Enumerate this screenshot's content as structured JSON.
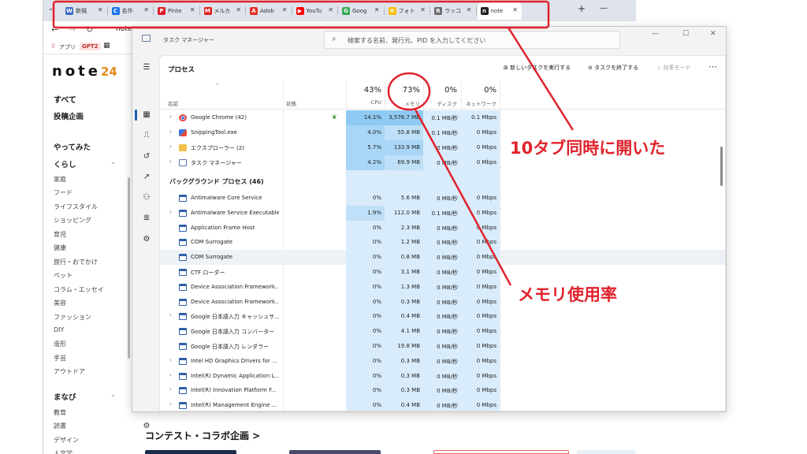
{
  "browser": {
    "tabs": [
      {
        "label": "新規",
        "fav_color": "#3a6fc4",
        "fav_char": "W"
      },
      {
        "label": "名作",
        "fav_color": "#1a73e8",
        "fav_char": "C"
      },
      {
        "label": "Pinte",
        "fav_color": "#e0192b",
        "fav_char": "P"
      },
      {
        "label": "メルカ",
        "fav_color": "#e02020",
        "fav_char": "M"
      },
      {
        "label": "Adob",
        "fav_color": "#e8302a",
        "fav_char": "A"
      },
      {
        "label": "YouTu",
        "fav_color": "#ff0000",
        "fav_char": "▶"
      },
      {
        "label": "Goog",
        "fav_color": "#34a853",
        "fav_char": "G"
      },
      {
        "label": "フォト",
        "fav_color": "#fbbc04",
        "fav_char": "✿"
      },
      {
        "label": "ラッコ",
        "fav_color": "#6b6b6b",
        "fav_char": "R"
      },
      {
        "label": "note",
        "fav_color": "#222222",
        "fav_char": "n"
      }
    ],
    "url": "note.",
    "bookmarks": {
      "apps": "アプリ",
      "gpt": "GPT2"
    },
    "colors": {
      "tabstrip": "#dfe3eb"
    }
  },
  "note": {
    "logo": "note",
    "logo_num": "24",
    "sidebar": [
      {
        "label": "すべて",
        "style": "bold"
      },
      {
        "label": "投稿企画",
        "style": "head"
      },
      {
        "label": "やってみた",
        "style": "head"
      },
      {
        "label": "くらし",
        "style": "head"
      },
      {
        "label": "家庭",
        "style": "small"
      },
      {
        "label": "フード",
        "style": "small"
      },
      {
        "label": "ライフスタイル",
        "style": "small"
      },
      {
        "label": "ショッピング",
        "style": "small"
      },
      {
        "label": "育児",
        "style": "small"
      },
      {
        "label": "健康",
        "style": "small"
      },
      {
        "label": "旅行・おでかけ",
        "style": "small"
      },
      {
        "label": "ペット",
        "style": "small"
      },
      {
        "label": "コラム・エッセイ",
        "style": "small"
      },
      {
        "label": "美容",
        "style": "small"
      },
      {
        "label": "ファッション",
        "style": "small"
      },
      {
        "label": "DIY",
        "style": "small"
      },
      {
        "label": "造形",
        "style": "small"
      },
      {
        "label": "手芸",
        "style": "small"
      },
      {
        "label": "アウトドア",
        "style": "small"
      },
      {
        "label": "まなび",
        "style": "head"
      },
      {
        "label": "教育",
        "style": "small"
      },
      {
        "label": "読書",
        "style": "small"
      },
      {
        "label": "デザイン",
        "style": "small"
      },
      {
        "label": "人文学",
        "style": "small"
      }
    ],
    "contest_heading": "コンテスト・コラボ企画 >"
  },
  "taskmanager": {
    "title": "タスク マネージャー",
    "search_placeholder": "検索する名前、発行元、PID を入力してください",
    "page_title": "プロセス",
    "toolbar": {
      "run_task": "新しいタスクを実行する",
      "end_task": "タスクを終了する",
      "efficiency": "効率モード"
    },
    "columns": {
      "name": "名前",
      "status": "状態",
      "cpu_pct": "43%",
      "cpu": "CPU",
      "mem_pct": "73%",
      "mem": "メモリ",
      "disk_pct": "0%",
      "disk": "ディスク",
      "net_pct": "0%",
      "net": "ネットワーク"
    },
    "apps": [
      {
        "name": "Google Chrome (42)",
        "cpu": "14.1%",
        "mem": "3,576.7 MB",
        "disk": "0.1 MB/秒",
        "net": "0.1 Mbps",
        "icon": "chrome",
        "exp": true,
        "leaf": true,
        "cpu_level": 3,
        "mem_level": 3
      },
      {
        "name": "SnippingTool.exe",
        "cpu": "4.0%",
        "mem": "55.8 MB",
        "disk": "0.1 MB/秒",
        "net": "0 Mbps",
        "icon": "snip",
        "exp": true,
        "leaf": false,
        "cpu_level": 2,
        "mem_level": 1
      },
      {
        "name": "エクスプローラー (2)",
        "cpu": "5.7%",
        "mem": "133.9 MB",
        "disk": "0 MB/秒",
        "net": "0 Mbps",
        "icon": "folder",
        "exp": true,
        "leaf": false,
        "cpu_level": 2,
        "mem_level": 2
      },
      {
        "name": "タスク マネージャー",
        "cpu": "4.2%",
        "mem": "69.9 MB",
        "disk": "0 MB/秒",
        "net": "0 Mbps",
        "icon": "tm",
        "exp": true,
        "leaf": false,
        "cpu_level": 2,
        "mem_level": 1
      }
    ],
    "bg_heading": "バックグラウンド プロセス (46)",
    "background": [
      {
        "name": "Antimalware Core Service",
        "cpu": "0%",
        "mem": "5.6 MB",
        "disk": "0 MB/秒",
        "net": "0 Mbps",
        "exp": false,
        "cpu_level": 0
      },
      {
        "name": "Antimalware Service Executable",
        "cpu": "1.9%",
        "mem": "112.0 MB",
        "disk": "0.1 MB/秒",
        "net": "0 Mbps",
        "exp": true,
        "cpu_level": 1
      },
      {
        "name": "Application Frame Host",
        "cpu": "0%",
        "mem": "2.3 MB",
        "disk": "0 MB/秒",
        "net": "0 Mbps",
        "exp": false,
        "cpu_level": 0
      },
      {
        "name": "COM Surrogate",
        "cpu": "0%",
        "mem": "1.2 MB",
        "disk": "0 MB/秒",
        "net": "0 Mbps",
        "exp": false,
        "cpu_level": 0
      },
      {
        "name": "COM Surrogate",
        "cpu": "0%",
        "mem": "0.8 MB",
        "disk": "0 MB/秒",
        "net": "0 Mbps",
        "exp": false,
        "cpu_level": 0,
        "hl": true
      },
      {
        "name": "CTF ローダー",
        "cpu": "0%",
        "mem": "3.1 MB",
        "disk": "0 MB/秒",
        "net": "0 Mbps",
        "exp": false,
        "cpu_level": 0
      },
      {
        "name": "Device Association Framework...",
        "cpu": "0%",
        "mem": "1.3 MB",
        "disk": "0 MB/秒",
        "net": "0 Mbps",
        "exp": false,
        "cpu_level": 0
      },
      {
        "name": "Device Association Framework...",
        "cpu": "0%",
        "mem": "0.3 MB",
        "disk": "0 MB/秒",
        "net": "0 Mbps",
        "exp": false,
        "cpu_level": 0
      },
      {
        "name": "Google 日本語入力 キャッシュサ...",
        "cpu": "0%",
        "mem": "0.4 MB",
        "disk": "0 MB/秒",
        "net": "0 Mbps",
        "exp": true,
        "cpu_level": 0
      },
      {
        "name": "Google 日本語入力 コンバーター",
        "cpu": "0%",
        "mem": "4.1 MB",
        "disk": "0 MB/秒",
        "net": "0 Mbps",
        "exp": false,
        "cpu_level": 0
      },
      {
        "name": "Google 日本語入力 レンダラー",
        "cpu": "0%",
        "mem": "19.8 MB",
        "disk": "0 MB/秒",
        "net": "0 Mbps",
        "exp": false,
        "cpu_level": 0
      },
      {
        "name": "Intel HD Graphics Drivers for ...",
        "cpu": "0%",
        "mem": "0.3 MB",
        "disk": "0 MB/秒",
        "net": "0 Mbps",
        "exp": true,
        "cpu_level": 0
      },
      {
        "name": "Intel(R) Dynamic Application L...",
        "cpu": "0%",
        "mem": "0.3 MB",
        "disk": "0 MB/秒",
        "net": "0 Mbps",
        "exp": true,
        "cpu_level": 0
      },
      {
        "name": "Intel(R) Innovation Platform F...",
        "cpu": "0%",
        "mem": "0.3 MB",
        "disk": "0 MB/秒",
        "net": "0 Mbps",
        "exp": true,
        "cpu_level": 0
      },
      {
        "name": "Intel(R) Management Engine ...",
        "cpu": "0%",
        "mem": "0.4 MB",
        "disk": "0 MB/秒",
        "net": "0 Mbps",
        "exp": true,
        "cpu_level": 0
      }
    ],
    "colors": {
      "heat0": "#d9ecfb",
      "heat1": "#bfe0f8",
      "heat2": "#a9d6f6",
      "heat3": "#8fcaf3"
    }
  },
  "annotations": {
    "tabs_note": "10タブ同時に開いた",
    "memory_note": "メモリ使用率",
    "color": "#e0222c"
  }
}
